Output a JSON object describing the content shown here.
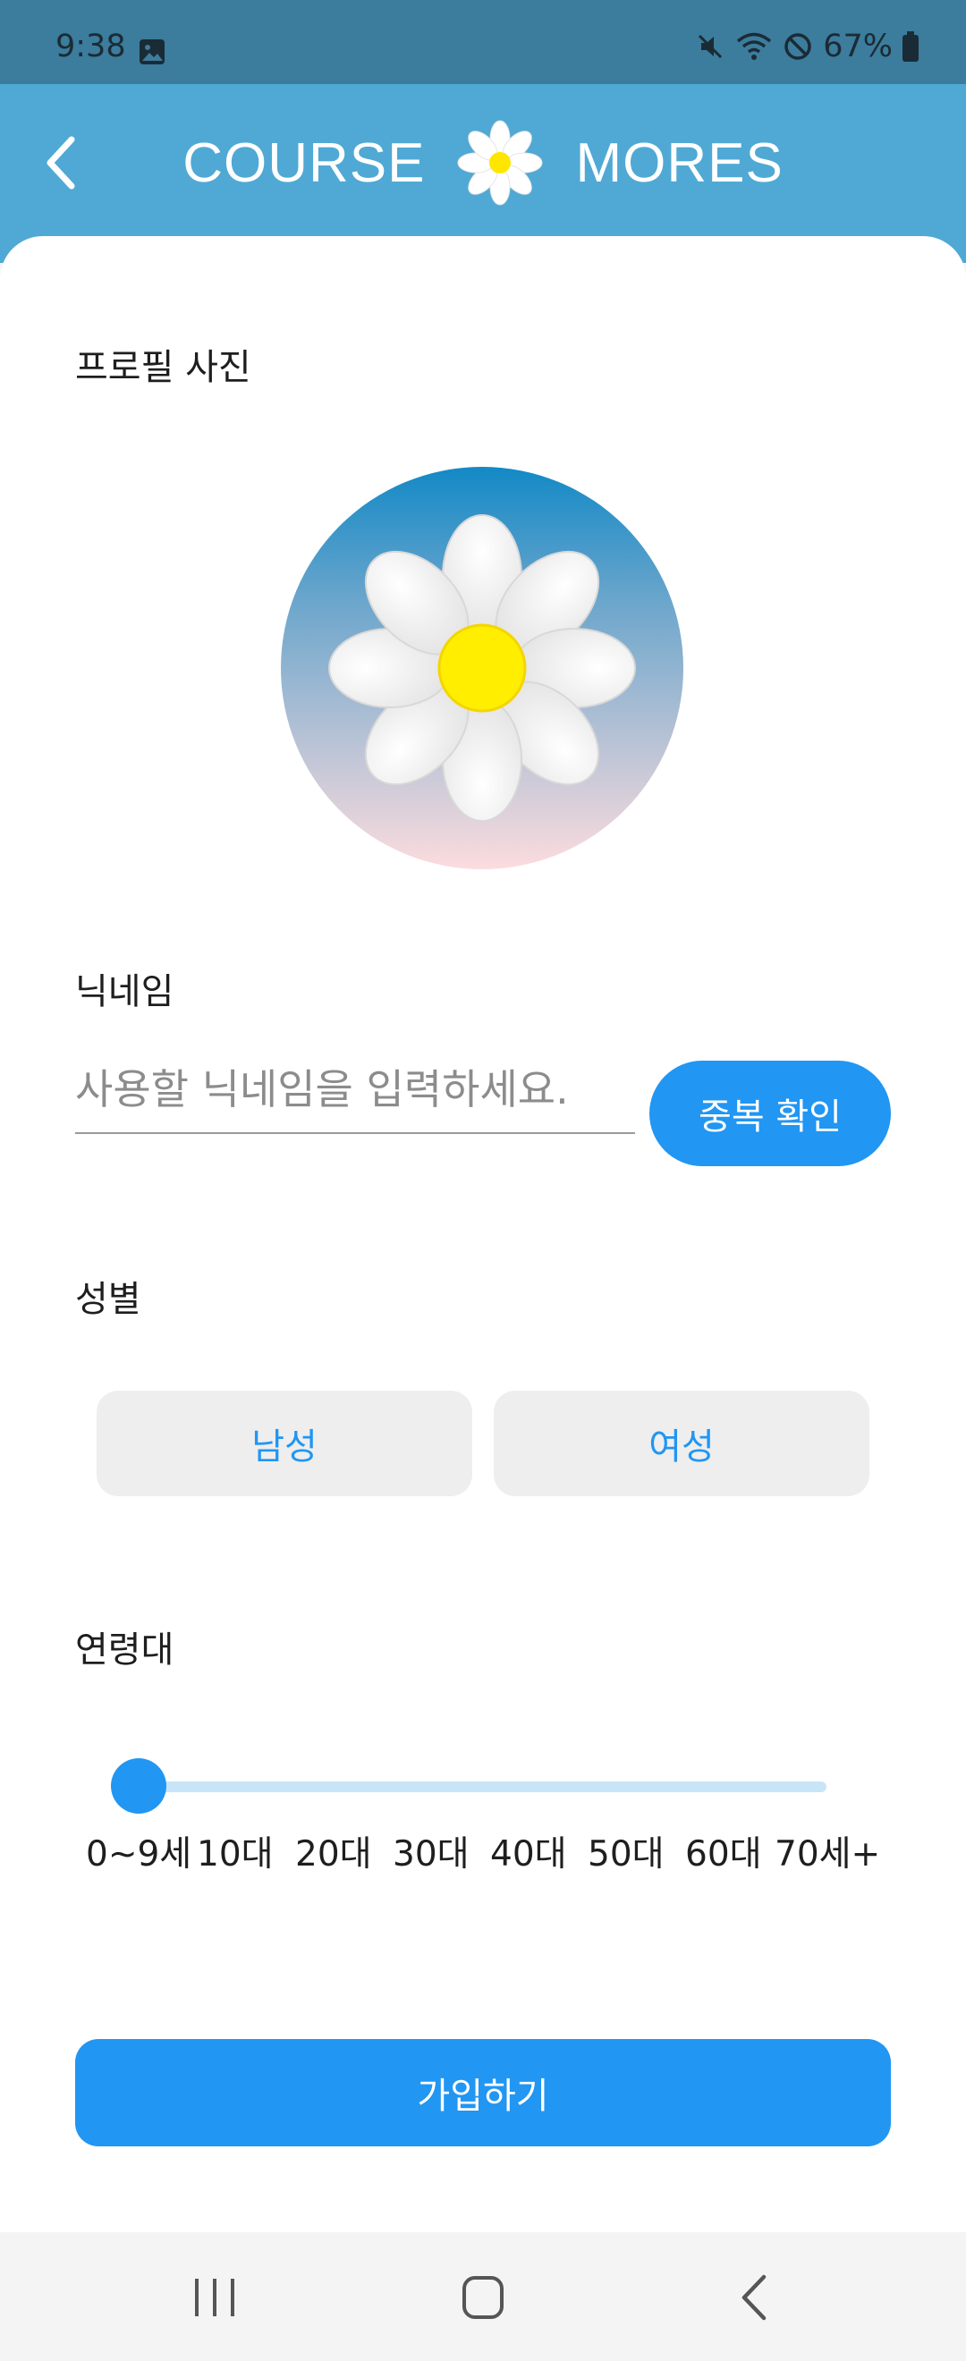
{
  "status_bar": {
    "time": "9:38",
    "battery": "67%",
    "icons": [
      "image-icon",
      "mute-icon",
      "wifi-icon",
      "block-icon",
      "battery-icon"
    ]
  },
  "app_bar": {
    "brand_left": "COURSE",
    "brand_right": "MORES",
    "logo": "daisy-flower-icon",
    "back": "back-arrow-icon"
  },
  "form": {
    "profile_photo_label": "프로필 사진",
    "nickname_label": "닉네임",
    "nickname_value": "",
    "nickname_placeholder": "사용할 닉네임을 입력하세요.",
    "duplicate_check_label": "중복 확인",
    "gender_label": "성별",
    "gender_options": [
      "남성",
      "여성"
    ],
    "age_label": "연령대",
    "age_options": [
      "0~9세",
      "10대",
      "20대",
      "30대",
      "40대",
      "50대",
      "60대",
      "70세+"
    ],
    "age_selected": "0~9세",
    "submit_label": "가입하기"
  },
  "colors": {
    "primary": "#2196F3",
    "app_bar": "#4FA9D4",
    "status_bar": "#3C7C9C",
    "gender_bg": "#EEEEEE"
  },
  "nav_bar": {
    "buttons": [
      "recent-apps-icon",
      "home-icon",
      "back-icon"
    ]
  }
}
